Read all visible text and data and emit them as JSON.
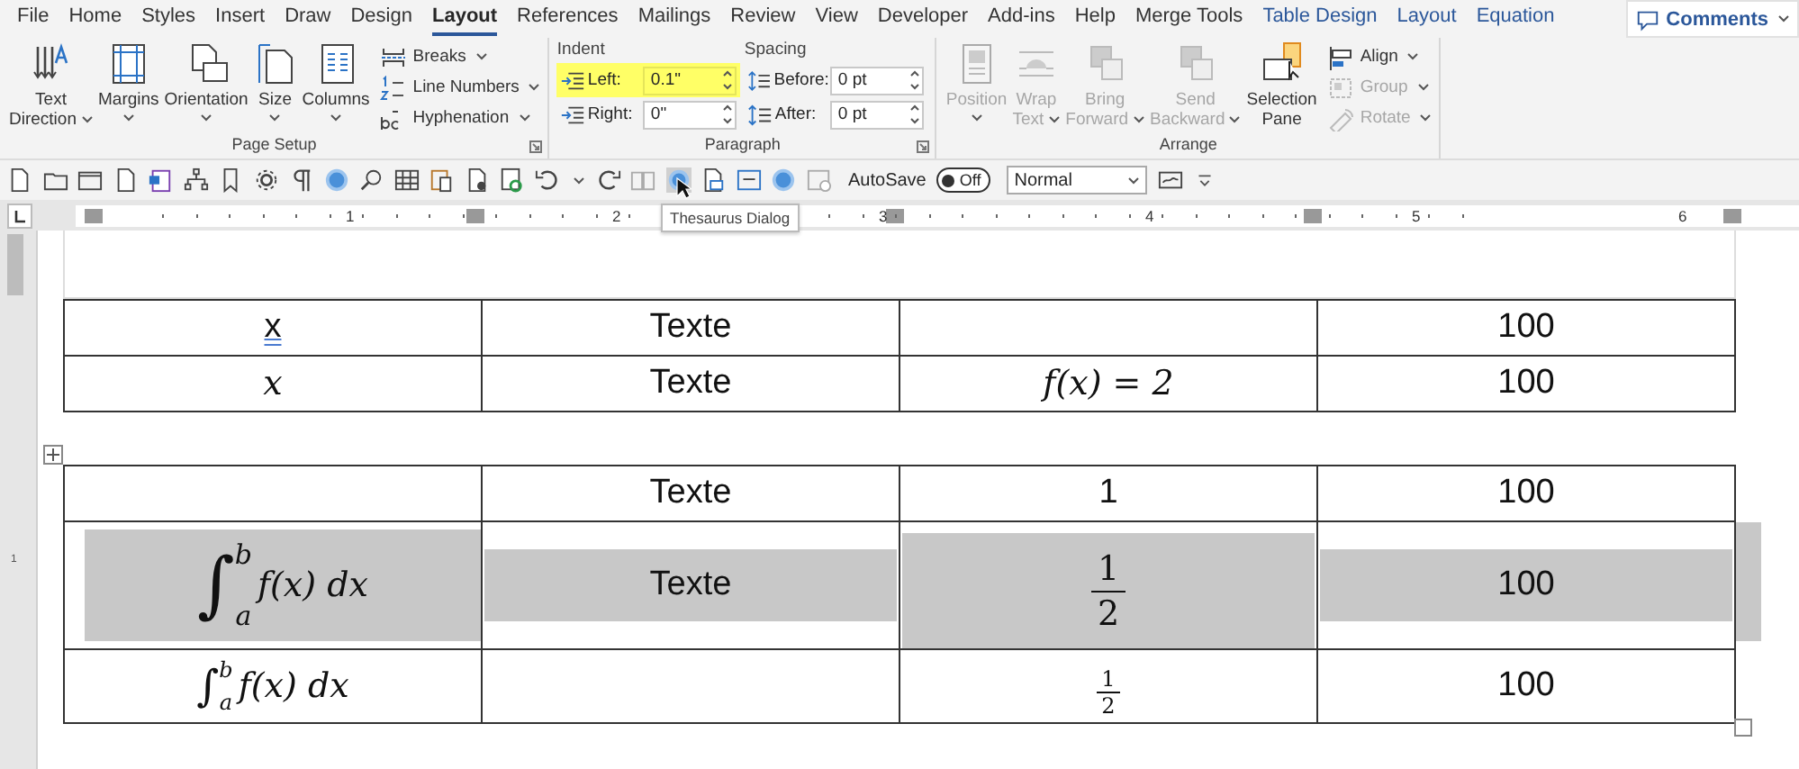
{
  "menu_tabs": [
    {
      "label": "File",
      "selected": false,
      "kind": "plain"
    },
    {
      "label": "Home",
      "selected": false,
      "kind": "plain"
    },
    {
      "label": "Styles",
      "selected": false,
      "kind": "plain"
    },
    {
      "label": "Insert",
      "selected": false,
      "kind": "plain"
    },
    {
      "label": "Draw",
      "selected": false,
      "kind": "plain"
    },
    {
      "label": "Design",
      "selected": false,
      "kind": "plain"
    },
    {
      "label": "Layout",
      "selected": true,
      "kind": "plain"
    },
    {
      "label": "References",
      "selected": false,
      "kind": "plain"
    },
    {
      "label": "Mailings",
      "selected": false,
      "kind": "plain"
    },
    {
      "label": "Review",
      "selected": false,
      "kind": "plain"
    },
    {
      "label": "View",
      "selected": false,
      "kind": "plain"
    },
    {
      "label": "Developer",
      "selected": false,
      "kind": "plain"
    },
    {
      "label": "Add-ins",
      "selected": false,
      "kind": "plain"
    },
    {
      "label": "Help",
      "selected": false,
      "kind": "plain"
    },
    {
      "label": "Merge Tools",
      "selected": false,
      "kind": "plain"
    },
    {
      "label": "Table Design",
      "selected": false,
      "kind": "context"
    },
    {
      "label": "Layout",
      "selected": false,
      "kind": "context"
    },
    {
      "label": "Equation",
      "selected": false,
      "kind": "context"
    }
  ],
  "comments_button": {
    "label": "Comments"
  },
  "ribbon_groups": [
    {
      "kind": "buttons",
      "title": "Page Setup",
      "items": [
        {
          "kind": "large",
          "lines": [
            "Text",
            "Direction"
          ],
          "dropdown": true,
          "disabled": false
        },
        {
          "kind": "large",
          "lines": [
            "Margins"
          ],
          "dropdown": true,
          "disabled": false
        },
        {
          "kind": "large",
          "lines": [
            "Orientation"
          ],
          "dropdown": true,
          "disabled": false
        },
        {
          "kind": "large",
          "lines": [
            "Size"
          ],
          "dropdown": true,
          "disabled": false
        },
        {
          "kind": "large",
          "lines": [
            "Columns"
          ],
          "dropdown": true,
          "disabled": false
        },
        {
          "kind": "stack",
          "items": [
            {
              "label": "Breaks",
              "dropdown": true,
              "disabled": false
            },
            {
              "label": "Line Numbers",
              "dropdown": true,
              "disabled": false
            },
            {
              "label": "Hyphenation",
              "dropdown": true,
              "disabled": false
            }
          ]
        }
      ]
    },
    {
      "kind": "paragraph",
      "title": "Paragraph",
      "sections": [
        {
          "title": "Indent",
          "fields": [
            {
              "label": "Left:",
              "value": "0.1\"",
              "highlighted": true
            },
            {
              "label": "Right:",
              "value": "0\"",
              "highlighted": false
            }
          ]
        },
        {
          "title": "Spacing",
          "fields": [
            {
              "label": "Before:",
              "value": "0 pt",
              "highlighted": false
            },
            {
              "label": "After:",
              "value": "0 pt",
              "highlighted": false
            }
          ]
        }
      ]
    },
    {
      "kind": "buttons",
      "title": "Arrange",
      "items": [
        {
          "kind": "large",
          "lines": [
            "Position"
          ],
          "dropdown": true,
          "disabled": true
        },
        {
          "kind": "large",
          "lines": [
            "Wrap",
            "Text"
          ],
          "dropdown": true,
          "disabled": true
        },
        {
          "kind": "large",
          "lines": [
            "Bring",
            "Forward"
          ],
          "dropdown": true,
          "disabled": true
        },
        {
          "kind": "large",
          "lines": [
            "Send",
            "Backward"
          ],
          "dropdown": true,
          "disabled": true
        },
        {
          "kind": "large",
          "lines": [
            "Selection",
            "Pane"
          ],
          "dropdown": false,
          "disabled": false
        },
        {
          "kind": "stack",
          "items": [
            {
              "label": "Align",
              "dropdown": true,
              "disabled": false
            },
            {
              "label": "Group",
              "dropdown": true,
              "disabled": true
            },
            {
              "label": "Rotate",
              "dropdown": true,
              "disabled": true
            }
          ]
        }
      ]
    }
  ],
  "quick_access": {
    "autosave": {
      "label": "AutoSave",
      "on": false,
      "state_label": "Off"
    },
    "style_box": {
      "value": "Normal"
    }
  },
  "tooltip": {
    "text": "Thesaurus Dialog"
  },
  "ruler": {
    "labels": [
      "1",
      "2",
      "3",
      "4",
      "5",
      "6"
    ]
  },
  "vertical_ruler": {
    "labels": [
      "1"
    ]
  },
  "tables": [
    {
      "rows": [
        {
          "selected": false,
          "cells": [
            {
              "kind": "text",
              "text": "x",
              "flagged": true
            },
            {
              "kind": "text",
              "text": "Texte",
              "flagged": false
            },
            {
              "kind": "empty"
            },
            {
              "kind": "text",
              "text": "100",
              "flagged": false
            }
          ]
        },
        {
          "selected": false,
          "cells": [
            {
              "kind": "math",
              "text": "x"
            },
            {
              "kind": "text",
              "text": "Texte",
              "flagged": false
            },
            {
              "kind": "math",
              "text": "f(x) = 2"
            },
            {
              "kind": "text",
              "text": "100",
              "flagged": false
            }
          ]
        }
      ]
    },
    {
      "rows": [
        {
          "selected": false,
          "cells": [
            {
              "kind": "empty"
            },
            {
              "kind": "text",
              "text": "Texte",
              "flagged": false
            },
            {
              "kind": "text",
              "text": "1",
              "flagged": false
            },
            {
              "kind": "text",
              "text": "100",
              "flagged": false
            }
          ]
        },
        {
          "selected": true,
          "cells": [
            {
              "kind": "integral",
              "display": true,
              "sign": "∫",
              "lower": "a",
              "upper": "b",
              "body": "f(x) dx"
            },
            {
              "kind": "text",
              "text": "Texte",
              "flagged": false
            },
            {
              "kind": "fraction",
              "display": true,
              "numerator": "1",
              "denominator": "2"
            },
            {
              "kind": "text",
              "text": "100",
              "flagged": false
            }
          ]
        },
        {
          "selected": false,
          "cells": [
            {
              "kind": "integral",
              "display": false,
              "sign": "∫",
              "lower": "a",
              "upper": "b",
              "body": "f(x) dx"
            },
            {
              "kind": "empty"
            },
            {
              "kind": "fraction",
              "display": false,
              "numerator": "1",
              "denominator": "2"
            },
            {
              "kind": "text",
              "text": "100",
              "flagged": false
            }
          ]
        }
      ]
    }
  ]
}
